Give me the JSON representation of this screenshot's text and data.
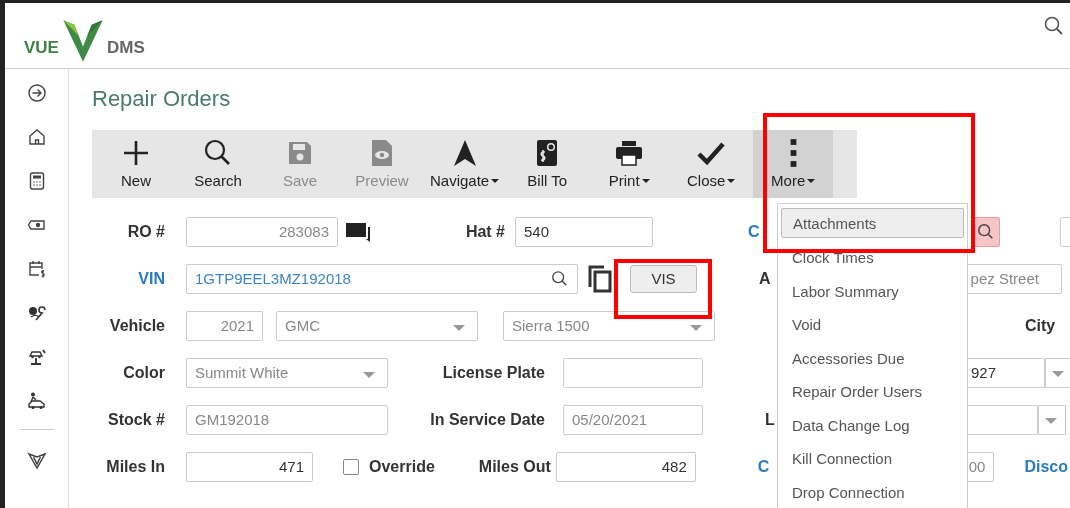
{
  "logo": {
    "left": "VUE",
    "right": "DMS"
  },
  "page_title": "Repair Orders",
  "toolbar": [
    {
      "kind": "plus",
      "label": "New",
      "disabled": false,
      "dropdown": false,
      "selected": false
    },
    {
      "kind": "search",
      "label": "Search",
      "disabled": false,
      "dropdown": false,
      "selected": false
    },
    {
      "kind": "save",
      "label": "Save",
      "disabled": true,
      "dropdown": false,
      "selected": false
    },
    {
      "kind": "preview",
      "label": "Preview",
      "disabled": true,
      "dropdown": false,
      "selected": false
    },
    {
      "kind": "navigate",
      "label": "Navigate",
      "disabled": false,
      "dropdown": true,
      "selected": false
    },
    {
      "kind": "bill",
      "label": "Bill To",
      "disabled": false,
      "dropdown": false,
      "selected": false
    },
    {
      "kind": "print",
      "label": "Print",
      "disabled": false,
      "dropdown": true,
      "selected": false
    },
    {
      "kind": "check",
      "label": "Close",
      "disabled": false,
      "dropdown": true,
      "selected": false
    },
    {
      "kind": "more",
      "label": "More",
      "disabled": false,
      "dropdown": true,
      "selected": true
    }
  ],
  "more_menu": [
    {
      "label": "Attachments",
      "selected": true
    },
    {
      "label": "Clock Times",
      "selected": false
    },
    {
      "label": "Labor Summary",
      "selected": false
    },
    {
      "label": "Void",
      "selected": false
    },
    {
      "label": "Accessories Due",
      "selected": false
    },
    {
      "label": "Repair Order Users",
      "selected": false
    },
    {
      "label": "Data Change Log",
      "selected": false
    },
    {
      "label": "Kill Connection",
      "selected": false
    },
    {
      "label": "Drop Connection",
      "selected": false
    }
  ],
  "form": {
    "ro_number": {
      "label": "RO #",
      "value": "283083",
      "disabled": true
    },
    "hat_number": {
      "label": "Hat #",
      "value": "540",
      "disabled": false
    },
    "vin": {
      "label": "VIN",
      "value": "1GTP9EEL3MZ192018",
      "button": "VIS"
    },
    "vehicle": {
      "label": "Vehicle",
      "year": "2021",
      "make": "GMC",
      "model": "Sierra 1500",
      "disabled": true
    },
    "color": {
      "label": "Color",
      "value": "Summit White",
      "disabled": true
    },
    "license_plate": {
      "label": "License Plate"
    },
    "stock_number": {
      "label": "Stock #",
      "value": "GM192018",
      "disabled": true
    },
    "in_service_date": {
      "label": "In Service Date",
      "value": "05/20/2021",
      "disabled": true
    },
    "miles_in": {
      "label": "Miles In",
      "value": "471",
      "disabled": false
    },
    "override": {
      "label": "Override",
      "checked": false
    },
    "miles_out": {
      "label": "Miles Out",
      "value": "482",
      "disabled": false
    }
  },
  "right_column": {
    "label_1": "C",
    "label_2": "A",
    "address": "pez Street",
    "city_label": "City",
    "zip": "927",
    "label_3": "L",
    "label_4": "C",
    "value": "00",
    "link": "Disco"
  }
}
